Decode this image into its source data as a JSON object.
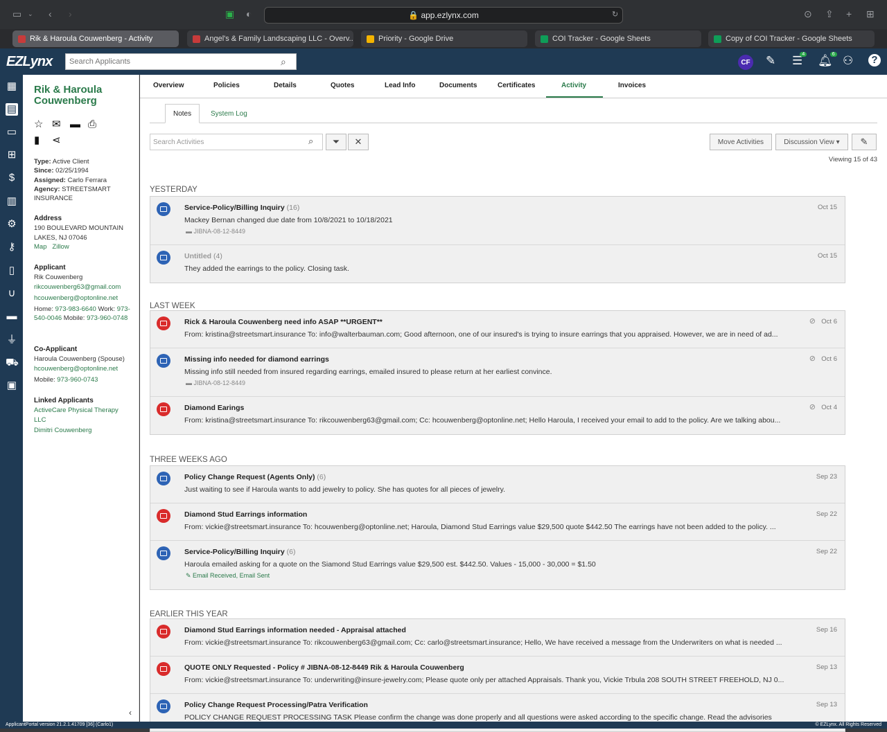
{
  "browser": {
    "url": "app.ezlynx.com",
    "tabs": [
      {
        "label": "Rik & Haroula Couwenberg - Activity",
        "color": "#c73b3b"
      },
      {
        "label": "Angel's & Family Landscaping LLC - Overv...",
        "color": "#c73b3b"
      },
      {
        "label": "Priority - Google Drive",
        "color": "#f4b400"
      },
      {
        "label": "COI Tracker - Google Sheets",
        "color": "#0f9d58"
      },
      {
        "label": "Copy of COI Tracker - Google Sheets",
        "color": "#0f9d58"
      }
    ]
  },
  "header": {
    "logo": "EZLynx",
    "search_placeholder": "Search Applicants",
    "user_initials": "CF",
    "tasks_badge": "4",
    "notif_badge": "6"
  },
  "client": {
    "name": "Rik & Haroula Couwenberg",
    "type_label": "Type:",
    "type": "Active Client",
    "since_label": "Since:",
    "since": "02/25/1994",
    "assigned_label": "Assigned:",
    "assigned": "Carlo Ferrara",
    "agency_label": "Agency:",
    "agency": "STREETSMART INSURANCE",
    "address_h": "Address",
    "address": "190 BOULEVARD MOUNTAIN LAKES, NJ 07046",
    "map": "Map",
    "zillow": "Zillow",
    "applicant_h": "Applicant",
    "applicant": "Rik Couwenberg",
    "applicant_email1": "rikcouwenberg63@gmail.com",
    "applicant_email2": "hcouwenberg@optonline.net",
    "home_label": "Home:",
    "home": "973-983-6640",
    "work_label": "Work:",
    "work": "973-540-0046",
    "mobile_label": "Mobile:",
    "mobile": "973-960-0748",
    "coapp_h": "Co-Applicant",
    "coapp": "Haroula Couwenberg (Spouse)",
    "coapp_email": "hcouwenberg@optonline.net",
    "coapp_mobile_label": "Mobile:",
    "coapp_mobile": "973-960-0743",
    "linked_h": "Linked Applicants",
    "linked1": "ActiveCare Physical Therapy LLC",
    "linked2": "Dimitri Couwenberg"
  },
  "nav": {
    "tabs": [
      "Overview",
      "Policies",
      "Details",
      "Quotes",
      "Lead Info",
      "Documents",
      "Certificates",
      "Activity",
      "Invoices"
    ],
    "subtabs": [
      "Notes",
      "System Log"
    ]
  },
  "toolbar": {
    "search_placeholder": "Search Activities",
    "move_activities": "Move Activities",
    "discussion_view": "Discussion View ▾",
    "viewing": "Viewing 15 of 43"
  },
  "groups": [
    {
      "title": "YESTERDAY",
      "items": [
        {
          "kind": "note",
          "title": "Service-Policy/Billing Inquiry",
          "count": "(16)",
          "body": "Mackey Bernan changed due date from 10/8/2021 to 10/18/2021",
          "tag": "JIBNA-08-12-8449",
          "date": "Oct 15"
        },
        {
          "kind": "note",
          "title": "Untitled",
          "count": "(4)",
          "body": "They added the earrings to the policy. Closing task.",
          "date": "Oct 15"
        }
      ]
    },
    {
      "title": "LAST WEEK",
      "items": [
        {
          "kind": "email",
          "title": "Rick & Haroula Couwenberg need info ASAP **URGENT**",
          "body": "From: kristina@streetsmart.insurance To: info@walterbauman.com; Good afternoon, one of our insured's is trying to insure earrings that you appraised. However, we are in need of ad...",
          "date": "Oct 6"
        },
        {
          "kind": "note",
          "title": "Missing info needed for diamond earrings",
          "body": "Missing info still needed from insured regarding earrings, emailed insured to please return at her earliest convince.",
          "tag": "JIBNA-08-12-8449",
          "date": "Oct 6"
        },
        {
          "kind": "email",
          "title": "Diamond Earings",
          "body": "From: kristina@streetsmart.insurance To: rikcouwenberg63@gmail.com; Cc: hcouwenberg@optonline.net; Hello Haroula, I received your email to add to the policy. Are we talking abou...",
          "date": "Oct 4"
        }
      ]
    },
    {
      "title": "THREE WEEKS AGO",
      "items": [
        {
          "kind": "note",
          "title": "Policy Change Request (Agents Only)",
          "count": "(6)",
          "body": "Just waiting to see if Haroula wants to add jewelry to policy. She has quotes for all pieces of jewelry.",
          "date": "Sep 23"
        },
        {
          "kind": "email",
          "title": "Diamond Stud Earrings information",
          "body": "From: vickie@streetsmart.insurance To: hcouwenberg@optonline.net; Haroula,    Diamond Stud Earrings value $29,500 quote $442.50 The earrings have not been added to the policy. ...",
          "date": "Sep 22"
        },
        {
          "kind": "note",
          "title": "Service-Policy/Billing Inquiry",
          "count": "(6)",
          "body": "Haroula emailed asking for a quote on the Siamond Stud Earrings value $29,500 est. $442.50. Values - 15,000 - 30,000 = $1.50",
          "tag": "Email Received, Email Sent",
          "date": "Sep 22"
        }
      ]
    },
    {
      "title": "EARLIER THIS YEAR",
      "items": [
        {
          "kind": "email",
          "title": "Diamond Stud Earrings information needed - Appraisal attached",
          "body": "From: vickie@streetsmart.insurance To: rikcouwenberg63@gmail.com; Cc: carlo@streetsmart.insurance; Hello, We have received a message from the Underwriters on what is needed ...",
          "date": "Sep 16"
        },
        {
          "kind": "email",
          "title": "QUOTE ONLY Requested - Policy # JIBNA-08-12-8449 Rik & Haroula Couwenberg",
          "body": "From: vickie@streetsmart.insurance To: underwriting@insure-jewelry.com; Please quote only per attached Appraisals. Thank you, Vickie Trbula 208 SOUTH STREET FREEHOLD, NJ 0...",
          "date": "Sep 13"
        },
        {
          "kind": "note",
          "title": "Policy Change Request Processing/Patra Verification",
          "body": "POLICY CHANGE REQUEST PROCESSING TASK Please confirm the change was done properly and all questions were asked according to the specific change. Read the advisories",
          "date": "Sep 13"
        }
      ]
    }
  ],
  "status": {
    "left": "ApplicantPortal version 21.2.1.41709 [36] (Carlo1)",
    "right": "© EZLynx. All Rights Reserved"
  }
}
